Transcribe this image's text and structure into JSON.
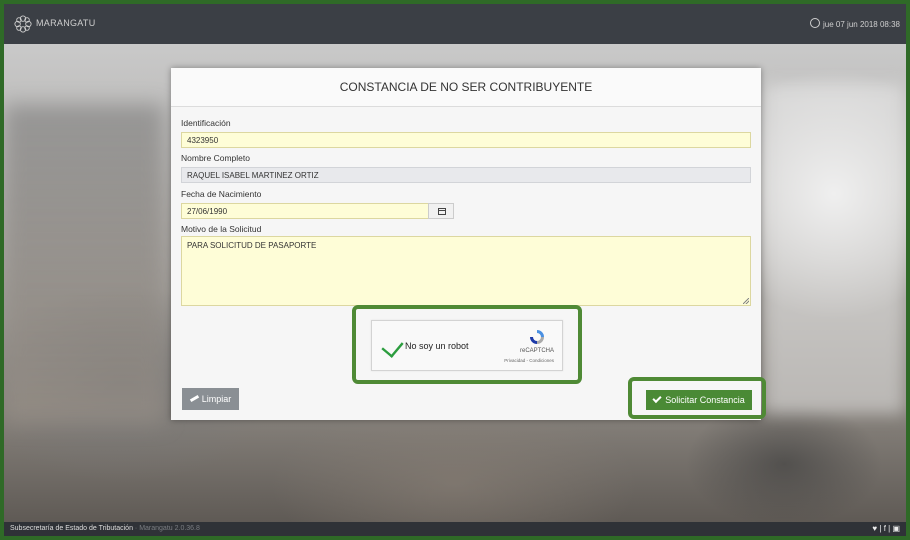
{
  "header": {
    "brand": "MARANGATU",
    "datetime": "jue 07 jun 2018 08:38"
  },
  "form": {
    "title": "CONSTANCIA DE NO SER CONTRIBUYENTE",
    "identificacion_label": "Identificación",
    "identificacion_value": "4323950",
    "nombre_label": "Nombre Completo",
    "nombre_value": "RAQUEL ISABEL MARTINEZ  ORTIZ",
    "fecha_label": "Fecha de Nacimiento",
    "fecha_value": "27/06/1990",
    "motivo_label": "Motivo de la Solicitud",
    "motivo_value": "PARA SOLICITUD DE PASAPORTE"
  },
  "captcha": {
    "text": "No soy un robot",
    "brand": "reCAPTCHA",
    "links": "Privacidad - Condiciones",
    "checked": true
  },
  "buttons": {
    "limpiar": "Limpiar",
    "solicitar": "Solicitar Constancia"
  },
  "footer": {
    "org": "Subsecretaría de Estado de Tributación",
    "version": " · Marangatu 2.0.36.8",
    "social": "♥ | f | ▣"
  },
  "colors": {
    "topbar": "#3b3f45",
    "field_yellow": "#fefdd7",
    "primary_green": "#4a8a35",
    "highlight_green": "#4f8a35"
  }
}
